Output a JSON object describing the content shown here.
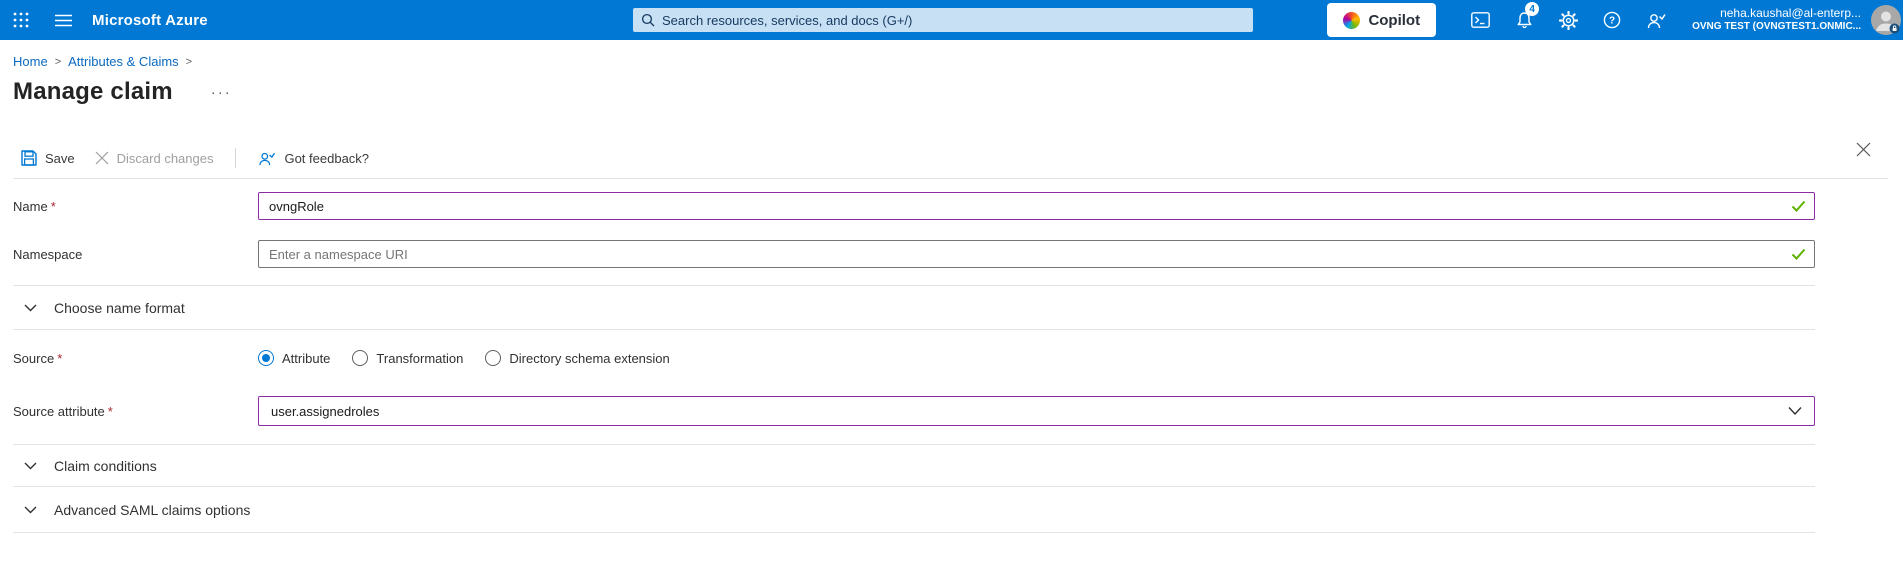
{
  "topbar": {
    "brand": "Microsoft Azure",
    "search_placeholder": "Search resources, services, and docs (G+/)",
    "copilot_label": "Copilot",
    "notification_count": "4",
    "user": {
      "email": "neha.kaushal@al-enterp...",
      "tenant": "OVNG TEST (OVNGTEST1.ONMIC..."
    }
  },
  "breadcrumb": {
    "items": [
      "Home",
      "Attributes & Claims"
    ],
    "separator": ">"
  },
  "page": {
    "title": "Manage claim",
    "more_options": "···"
  },
  "toolbar": {
    "save": "Save",
    "discard": "Discard changes",
    "feedback": "Got feedback?"
  },
  "form": {
    "required_marker": "*",
    "name": {
      "label": "Name",
      "value": "ovngRole"
    },
    "namespace": {
      "label": "Namespace",
      "placeholder": "Enter a namespace URI"
    },
    "source": {
      "label": "Source",
      "options": [
        "Attribute",
        "Transformation",
        "Directory schema extension"
      ],
      "selected": "Attribute"
    },
    "source_attribute": {
      "label": "Source attribute",
      "value": "user.assignedroles"
    }
  },
  "sections": [
    {
      "label": "Choose name format"
    },
    {
      "label": "Claim conditions"
    },
    {
      "label": "Advanced SAML claims options"
    }
  ],
  "colors": {
    "topbar": "#0078d4",
    "search_bg": "#c7e0f4",
    "dirty_border": "#8a2da5",
    "valid_green": "#5db300",
    "required_red": "#a4262c",
    "link_blue": "#0b6ac1"
  }
}
